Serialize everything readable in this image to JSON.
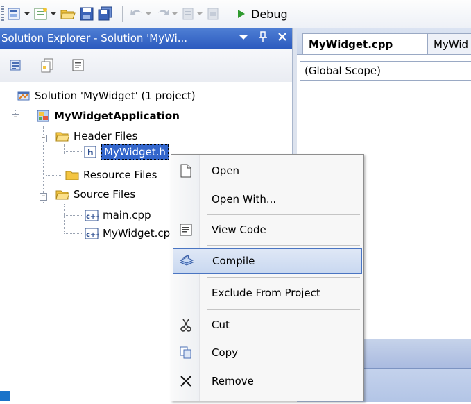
{
  "toolbar": {
    "debug_label": "Debug"
  },
  "solution_explorer": {
    "title": "Solution Explorer - Solution 'MyWi...",
    "pin_glyph": "↓",
    "pin2_glyph": "∙",
    "close_glyph": "✕"
  },
  "tree": {
    "solution": "Solution 'MyWidget' (1 project)",
    "project": "MyWidgetApplication",
    "header_files": "Header Files",
    "header_file": "MyWidget.h",
    "resource_files": "Resource Files",
    "source_files": "Source Files",
    "main_cpp": "main.cpp",
    "mywidget_cpp": "MyWidget.cpp"
  },
  "editor": {
    "tab_active": "MyWidget.cpp",
    "tab_inactive": "MyWid",
    "scope": "(Global Scope)"
  },
  "context_menu": {
    "open": "Open",
    "open_with": "Open With...",
    "view_code": "View Code",
    "compile": "Compile",
    "exclude": "Exclude From Project",
    "cut": "Cut",
    "copy": "Copy",
    "remove": "Remove"
  },
  "colors": {
    "title_bar": "#2c5bbf",
    "selection": "#3366cc",
    "menu_highlight_border": "#4a75c2"
  }
}
